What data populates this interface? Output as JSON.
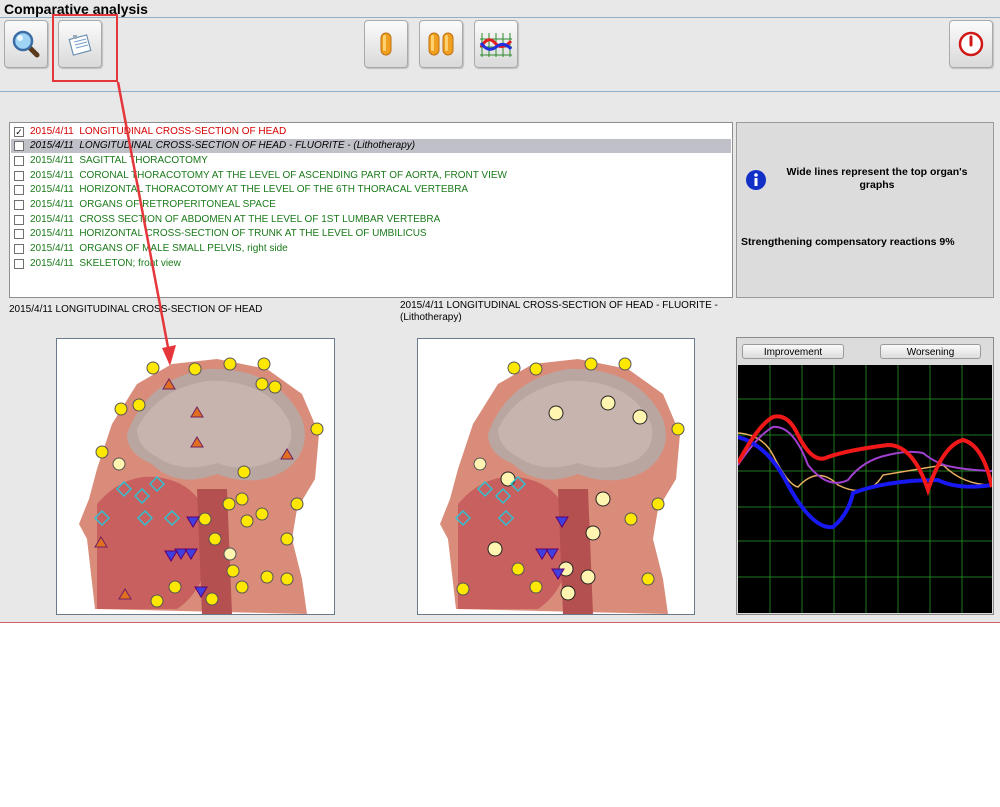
{
  "window": {
    "title": "Comparative analysis"
  },
  "toolbar": {
    "buttons": [
      {
        "name": "magnifier-icon"
      },
      {
        "name": "notes-icon",
        "highlighted": true
      },
      {
        "name": "single-capsule-icon"
      },
      {
        "name": "double-capsule-icon"
      },
      {
        "name": "graph-icon"
      },
      {
        "name": "power-icon"
      }
    ],
    "highlight_color": "#e5373b"
  },
  "analysis_list": {
    "items": [
      {
        "date": "2015/4/11",
        "label": "LONGITUDINAL CROSS-SECTION OF HEAD",
        "checked": true,
        "color": "#d40000"
      },
      {
        "date": "2015/4/11",
        "label": "LONGITUDINAL CROSS-SECTION OF HEAD - FLUORITE - (Lithotherapy)",
        "checked": false,
        "color": "#000000",
        "selected": true
      },
      {
        "date": "2015/4/11",
        "label": "SAGITTAL THORACOTOMY",
        "checked": false,
        "color": "#1a7a1a"
      },
      {
        "date": "2015/4/11",
        "label": "CORONAL THORACOTOMY AT THE LEVEL OF ASCENDING PART OF AORTA, FRONT VIEW",
        "checked": false,
        "color": "#1a7a1a"
      },
      {
        "date": "2015/4/11",
        "label": "HORIZONTAL THORACOTOMY AT THE LEVEL OF THE 6TH THORACAL VERTEBRA",
        "checked": false,
        "color": "#1a7a1a"
      },
      {
        "date": "2015/4/11",
        "label": "ORGANS OF RETROPERITONEAL SPACE",
        "checked": false,
        "color": "#1a7a1a"
      },
      {
        "date": "2015/4/11",
        "label": "CROSS SECTION OF ABDOMEN AT THE LEVEL OF 1ST LUMBAR VERTEBRA",
        "checked": false,
        "color": "#1a7a1a"
      },
      {
        "date": "2015/4/11",
        "label": "HORIZONTAL CROSS-SECTION OF TRUNK AT THE LEVEL OF UMBILICUS",
        "checked": false,
        "color": "#1a7a1a"
      },
      {
        "date": "2015/4/11",
        "label": "ORGANS OF MALE SMALL PELVIS, right side",
        "checked": false,
        "color": "#1a7a1a"
      },
      {
        "date": "2015/4/11",
        "label": "SKELETON; front view",
        "checked": false,
        "color": "#1a7a1a"
      }
    ]
  },
  "info_panel": {
    "icon": "info-icon",
    "note": "Wide lines represent the top organ's graphs",
    "status": "Strengthening compensatory reactions 9%"
  },
  "captions": {
    "left": "2015/4/11  LONGITUDINAL CROSS-SECTION OF HEAD",
    "right": "2015/4/11  LONGITUDINAL CROSS-SECTION OF HEAD - FLUORITE - (Lithotherapy)"
  },
  "graph_panel": {
    "improvement_label": "Improvement",
    "worsening_label": "Worsening",
    "line_colors": [
      "#0000ff",
      "#ff0000",
      "#a040d0",
      "#e0b060"
    ]
  }
}
